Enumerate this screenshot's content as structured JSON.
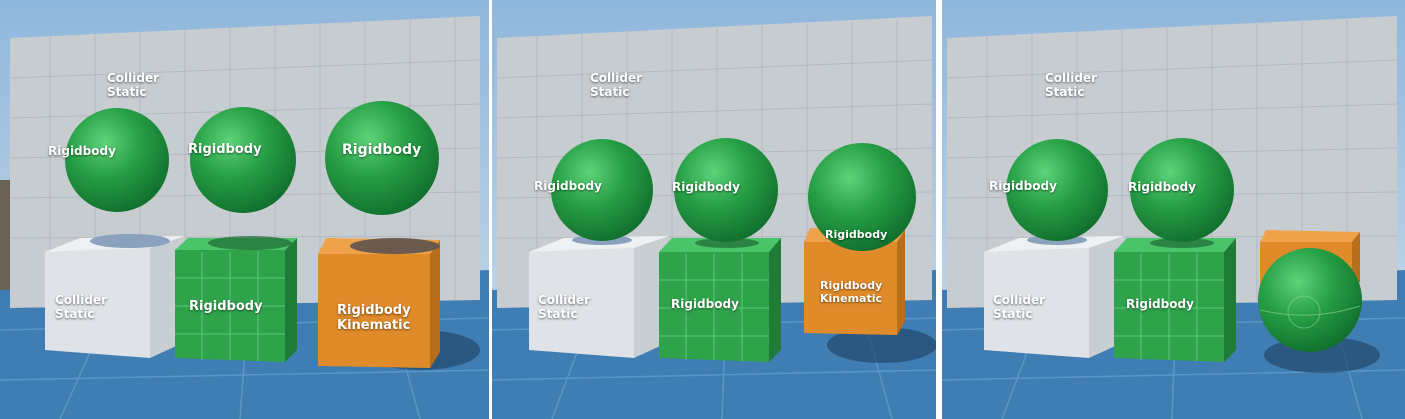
{
  "colors": {
    "sky_top": "#8fb7dc",
    "sky_bottom": "#c8d8e6",
    "wall": "#c7ccd1",
    "wall_line": "#b2b8be",
    "floor": "#3f7db3",
    "floor_line": "#5a97c9",
    "white_cube": "#dfe3e7",
    "green_cube": "#2ea34a",
    "orange_cube": "#e08b2a",
    "sphere": "#27a046",
    "shadow": "#23486b"
  },
  "labels": {
    "collider": "Collider",
    "static": "Static",
    "rigidbody": "Rigidbody",
    "kinematic": "Kinematic"
  },
  "panels": [
    {
      "id": "before",
      "state": "spheres-suspended"
    },
    {
      "id": "landed",
      "state": "spheres-resting"
    },
    {
      "id": "pushed",
      "state": "kinematic-sphere-falls"
    }
  ]
}
